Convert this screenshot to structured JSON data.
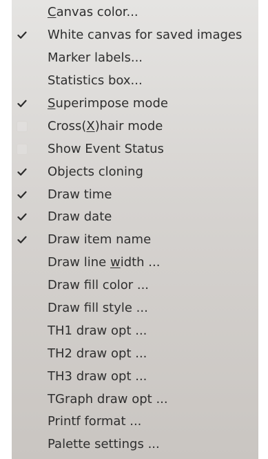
{
  "menu": {
    "items": [
      {
        "label": "Canvas color...",
        "checkbox": "none",
        "underline_index": 0,
        "underline_len": 1
      },
      {
        "label": "White canvas for saved images",
        "checkbox": "checked"
      },
      {
        "label": "Marker labels...",
        "checkbox": "none"
      },
      {
        "label": "Statistics box...",
        "checkbox": "none"
      },
      {
        "label": "Superimpose mode",
        "checkbox": "checked",
        "underline_index": 0,
        "underline_len": 1
      },
      {
        "label": "Cross(X)hair mode",
        "checkbox": "unchecked",
        "underline_index": 6,
        "underline_len": 1
      },
      {
        "label": "Show Event Status",
        "checkbox": "unchecked"
      },
      {
        "label": "Objects cloning",
        "checkbox": "checked"
      },
      {
        "label": "Draw time",
        "checkbox": "checked"
      },
      {
        "label": "Draw date",
        "checkbox": "checked"
      },
      {
        "label": "Draw item name",
        "checkbox": "checked"
      },
      {
        "label": "Draw line width ...",
        "checkbox": "none",
        "underline_index": 10,
        "underline_len": 1
      },
      {
        "label": "Draw fill color ...",
        "checkbox": "none"
      },
      {
        "label": "Draw fill style ...",
        "checkbox": "none"
      },
      {
        "label": "TH1 draw opt ...",
        "checkbox": "none"
      },
      {
        "label": "TH2 draw opt ...",
        "checkbox": "none"
      },
      {
        "label": "TH3 draw opt ...",
        "checkbox": "none"
      },
      {
        "label": "TGraph draw opt ...",
        "checkbox": "none"
      },
      {
        "label": "Printf format ...",
        "checkbox": "none"
      },
      {
        "label": "Palette settings ...",
        "checkbox": "none"
      }
    ]
  },
  "colors": {
    "text": "#2e2e2e",
    "check": "#2b2b2b",
    "menu_top": "#e5e4e2",
    "menu_bottom": "#c9c5c1"
  },
  "icons": {
    "checked": "checkmark-icon",
    "unchecked": "empty-checkbox-icon"
  }
}
